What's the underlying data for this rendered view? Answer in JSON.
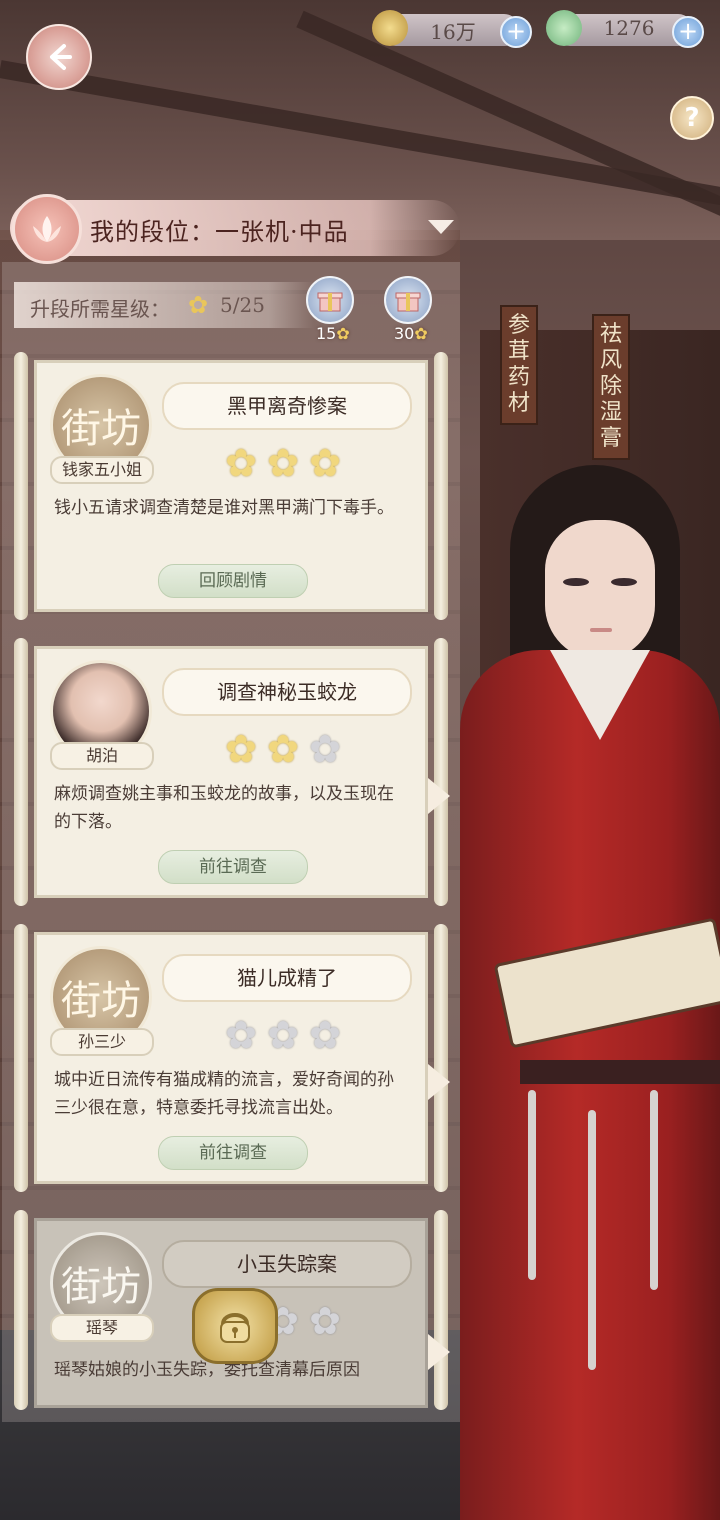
{
  "resources": {
    "coins": {
      "icon": "paw-coin-icon",
      "value": "16万"
    },
    "jade": {
      "icon": "jade-gem-icon",
      "value": "1276"
    }
  },
  "help": {
    "label": "?"
  },
  "rank": {
    "text": "我的段位：一张机·中品"
  },
  "requirement": {
    "label": "升段所需星级：",
    "progress": "5/25"
  },
  "gifts": [
    {
      "icon": "gift-box-icon",
      "stars": "15"
    },
    {
      "icon": "gift-box-icon",
      "stars": "30"
    }
  ],
  "cases": [
    {
      "title": "黑甲离奇惨案",
      "client": "钱家五小姐",
      "portrait_glyph": "街坊",
      "stars": [
        1,
        1,
        1
      ],
      "description": "钱小五请求调查清楚是谁对黑甲满门下毒手。",
      "action": "回顾剧情",
      "locked": false
    },
    {
      "title": "调查神秘玉蛟龙",
      "client": "胡泊",
      "portrait_glyph": "",
      "stars": [
        1,
        1,
        0
      ],
      "description": "麻烦调查姚主事和玉蛟龙的故事，以及玉现在的下落。",
      "action": "前往调查",
      "locked": false
    },
    {
      "title": "猫儿成精了",
      "client": "孙三少",
      "portrait_glyph": "街坊",
      "stars": [
        0,
        0,
        0
      ],
      "description": "城中近日流传有猫成精的流言，爱好奇闻的孙三少很在意，特意委托寻找流言出处。",
      "action": "前往调查",
      "locked": false
    },
    {
      "title": "小玉失踪案",
      "client": "瑶琴",
      "portrait_glyph": "街坊",
      "stars": [
        0,
        0,
        0
      ],
      "description": "瑶琴姑娘的小玉失踪，委托查清幕后原因",
      "action": "",
      "locked": true
    }
  ],
  "plaques": [
    "参茸药材",
    "祛风除湿膏"
  ],
  "colors": {
    "accent": "#d78c82",
    "star_on": "#f1d77e",
    "star_off": "#d4d4d8",
    "robe": "#b52a27"
  }
}
